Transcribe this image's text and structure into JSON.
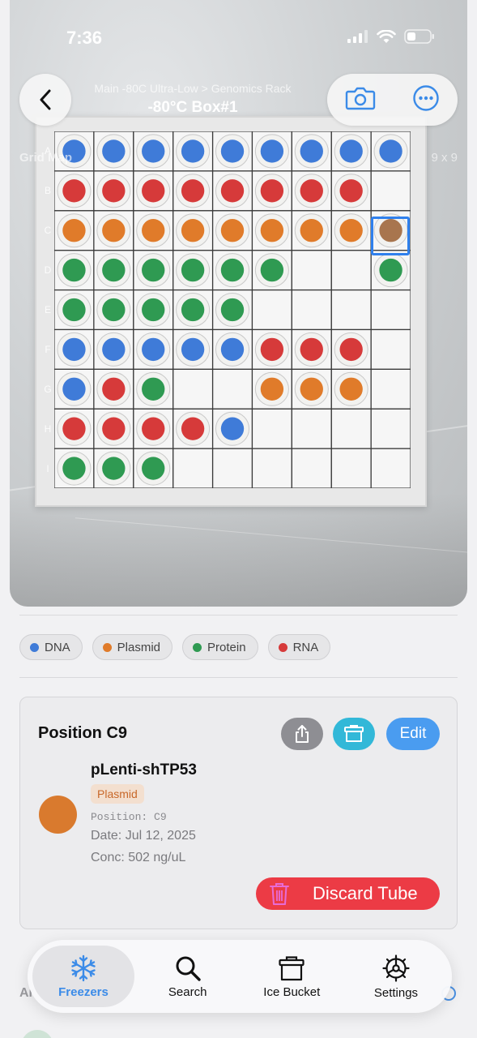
{
  "status_bar": {
    "time": "7:36"
  },
  "nav": {
    "breadcrumb": "Main -80C Ultra-Low > Genomics Rack",
    "title": "-80°C Box#1"
  },
  "grid_map": {
    "label": "Grid Map",
    "size": "9 x 9",
    "rows": [
      "A",
      "B",
      "C",
      "D",
      "E",
      "F",
      "G",
      "H",
      "I"
    ],
    "cells": [
      [
        "DNA",
        "DNA",
        "DNA",
        "DNA",
        "DNA",
        "DNA",
        "DNA",
        "DNA",
        "DNA"
      ],
      [
        "RNA",
        "RNA",
        "RNA",
        "RNA",
        "RNA",
        "RNA",
        "RNA",
        "RNA",
        ""
      ],
      [
        "Plasmid",
        "Plasmid",
        "Plasmid",
        "Plasmid",
        "Plasmid",
        "Plasmid",
        "Plasmid",
        "Plasmid",
        "Plasmid"
      ],
      [
        "Protein",
        "Protein",
        "Protein",
        "Protein",
        "Protein",
        "Protein",
        "",
        "",
        "Protein"
      ],
      [
        "Protein",
        "Protein",
        "Protein",
        "Protein",
        "Protein",
        "",
        "",
        "",
        ""
      ],
      [
        "DNA",
        "DNA",
        "DNA",
        "DNA",
        "DNA",
        "RNA",
        "RNA",
        "RNA",
        ""
      ],
      [
        "DNA",
        "RNA",
        "Protein",
        "",
        "",
        "Plasmid",
        "Plasmid",
        "Plasmid",
        ""
      ],
      [
        "RNA",
        "RNA",
        "RNA",
        "RNA",
        "DNA",
        "",
        "",
        "",
        ""
      ],
      [
        "Protein",
        "Protein",
        "Protein",
        "",
        "",
        "",
        "",
        "",
        ""
      ]
    ],
    "selected": {
      "row": 2,
      "col": 8
    }
  },
  "legend": [
    {
      "label": "DNA",
      "color": "#3f7bd8"
    },
    {
      "label": "Plasmid",
      "color": "#e07b2a"
    },
    {
      "label": "Protein",
      "color": "#2f9a52"
    },
    {
      "label": "RNA",
      "color": "#d63a3a"
    }
  ],
  "detail": {
    "title": "Position C9",
    "edit_label": "Edit",
    "sample_name": "pLenti-shTP53",
    "type": "Plasmid",
    "position": "Position: C9",
    "date": "Date: Jul 12, 2025",
    "conc": "Conc: 502 ng/uL",
    "discard_label": "Discard Tube",
    "swatch_color": "#d97a2e"
  },
  "peek_text": "Ar",
  "tabs": [
    {
      "label": "Freezers",
      "icon": "snowflake-icon",
      "active": true
    },
    {
      "label": "Search",
      "icon": "magnifier-icon",
      "active": false
    },
    {
      "label": "Ice Bucket",
      "icon": "bucket-icon",
      "active": false
    },
    {
      "label": "Settings",
      "icon": "gear-icon",
      "active": false
    }
  ]
}
